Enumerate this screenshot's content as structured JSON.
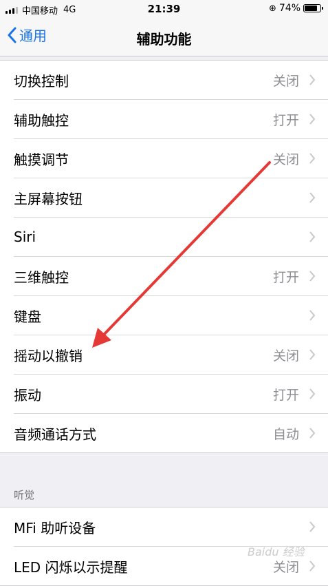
{
  "status_bar": {
    "carrier": "中国移动",
    "network": "4G",
    "time": "21:39",
    "battery": "74%"
  },
  "nav": {
    "back_label": "通用",
    "title": "辅助功能"
  },
  "rows": [
    {
      "label": "切换控制",
      "value": "关闭"
    },
    {
      "label": "辅助触控",
      "value": "打开"
    },
    {
      "label": "触摸调节",
      "value": "关闭"
    },
    {
      "label": "主屏幕按钮",
      "value": ""
    },
    {
      "label": "Siri",
      "value": ""
    },
    {
      "label": "三维触控",
      "value": "打开"
    },
    {
      "label": "键盘",
      "value": ""
    },
    {
      "label": "摇动以撤销",
      "value": "关闭"
    },
    {
      "label": "振动",
      "value": "打开"
    },
    {
      "label": "音频通话方式",
      "value": "自动"
    }
  ],
  "hearing_section": {
    "header": "听觉",
    "rows": [
      {
        "label": "MFi 助听设备",
        "value": ""
      },
      {
        "label": "LED 闪烁以示提醒",
        "value": "关闭"
      }
    ]
  },
  "annotation": {
    "color": "#e53935"
  },
  "watermark": "Baidu 经验",
  "colors": {
    "accent": "#1a73e8",
    "background": "#efeff4",
    "secondary_text": "#8e8e93"
  }
}
